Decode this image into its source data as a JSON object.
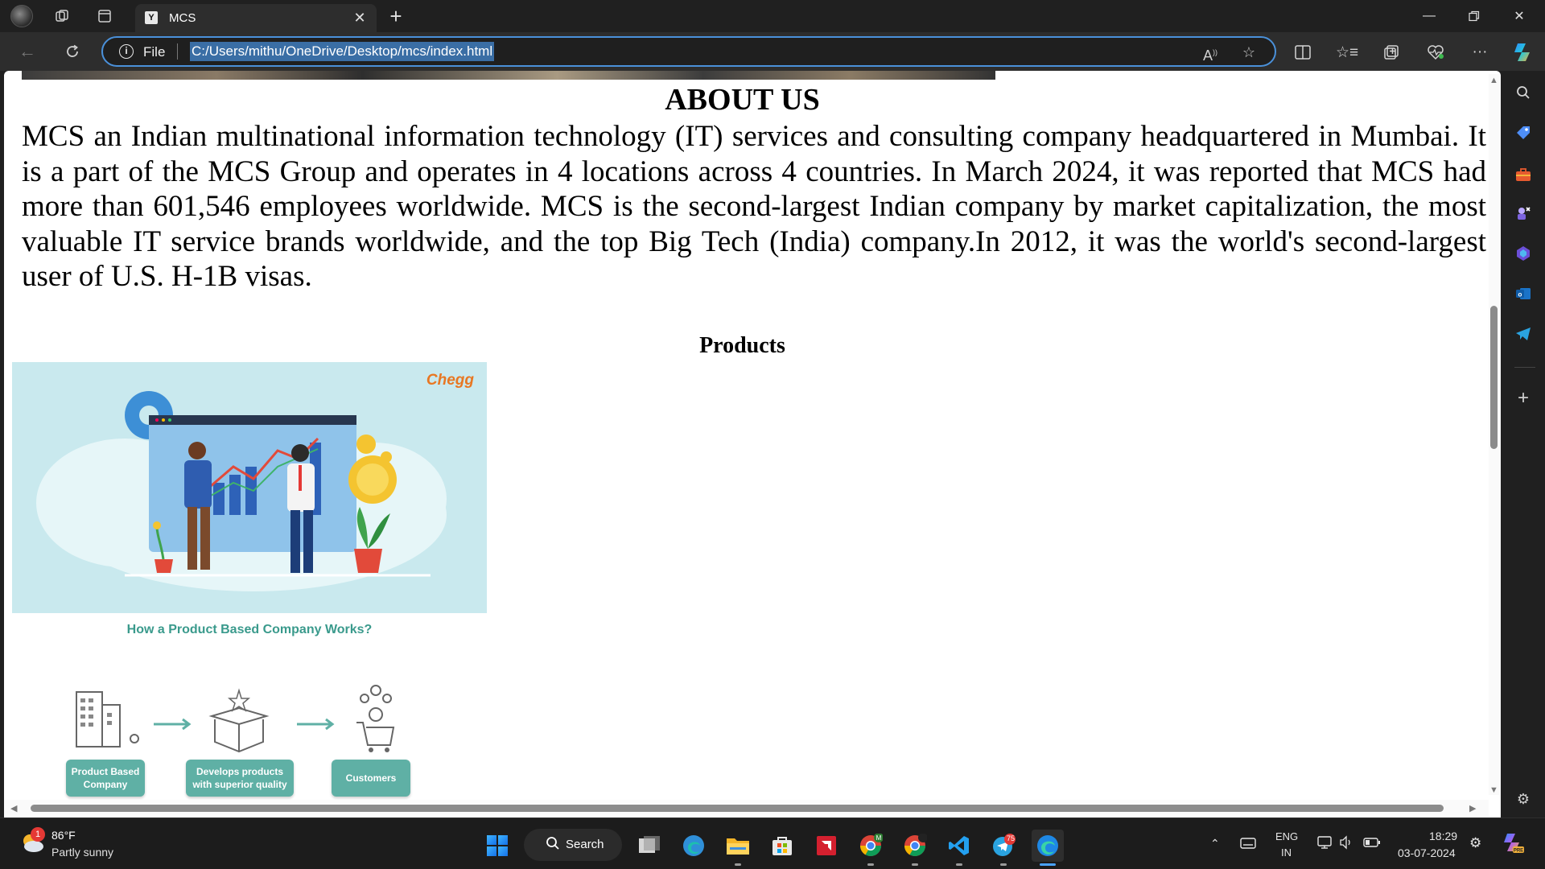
{
  "browser": {
    "tab_title": "MCS",
    "tab_favicon": "Y",
    "address": {
      "scheme_label": "File",
      "url": "C:/Users/mithu/OneDrive/Desktop/mcs/index.html"
    }
  },
  "page": {
    "about_title": "ABOUT US",
    "about_text": "MCS an Indian multinational information technology (IT) services and consulting company headquartered in Mumbai. It is a part of the MCS Group and operates in 4 locations across 4 countries. In March 2024, it was reported that MCS had more than 601,546 employees worldwide. MCS is the second-largest Indian company by market capitalization, the most valuable IT service brands worldwide, and the top Big Tech (India) company.In 2012, it was the world's second-largest user of U.S. H-1B visas.",
    "products_title": "Products",
    "product_image": {
      "brand": "Chegg"
    },
    "diagram": {
      "title": "How a Product Based Company Works?",
      "steps": [
        "Product Based Company",
        "Develops products with superior quality",
        "Customers"
      ]
    }
  },
  "taskbar": {
    "weather": {
      "temp": "86°F",
      "desc": "Partly sunny",
      "badge": "1"
    },
    "search_label": "Search",
    "telegram_badge": "75",
    "language": {
      "line1": "ENG",
      "line2": "IN"
    },
    "clock": {
      "time": "18:29",
      "date": "03-07-2024"
    }
  },
  "colors": {
    "accent": "#4a90d9",
    "diagram_teal": "#5fb0a5",
    "chegg_orange": "#e87722",
    "image_bg": "#c9e9ee"
  }
}
